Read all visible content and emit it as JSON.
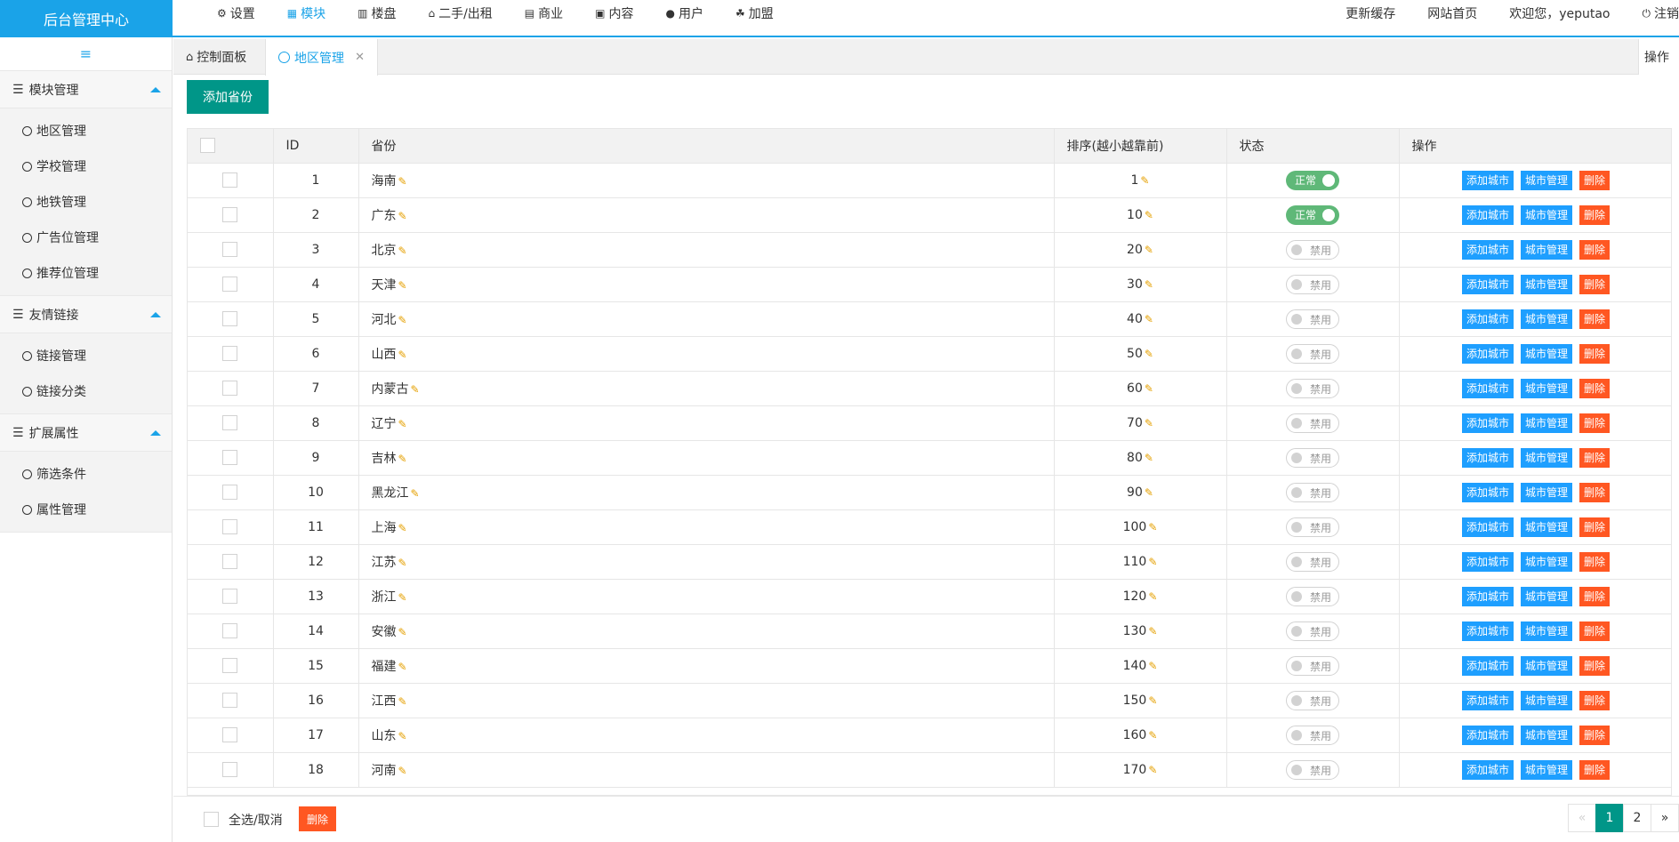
{
  "app": {
    "logo": "后台管理中心"
  },
  "topnav": [
    {
      "icon": "gear-icon",
      "glyph": "⚙",
      "label": "设置",
      "active": false
    },
    {
      "icon": "grid-icon",
      "glyph": "▦",
      "label": "模块",
      "active": true
    },
    {
      "icon": "building-icon",
      "glyph": "▥",
      "label": "楼盘",
      "active": false
    },
    {
      "icon": "home-icon",
      "glyph": "⌂",
      "label": "二手/出租",
      "active": false
    },
    {
      "icon": "bank-icon",
      "glyph": "▤",
      "label": "商业",
      "active": false
    },
    {
      "icon": "document-icon",
      "glyph": "▣",
      "label": "内容",
      "active": false
    },
    {
      "icon": "user-icon",
      "glyph": "●",
      "label": "用户",
      "active": false
    },
    {
      "icon": "users-icon",
      "glyph": "☘",
      "label": "加盟",
      "active": false
    }
  ],
  "topright": {
    "refresh_cache": "更新缓存",
    "site_home": "网站首页",
    "welcome": "欢迎您，yeputao",
    "logout_icon": "⏻",
    "logout": "注销"
  },
  "sidebar": {
    "toggle_icon": "≡",
    "groups": [
      {
        "title": "模块管理",
        "items": [
          "地区管理",
          "学校管理",
          "地铁管理",
          "广告位管理",
          "推荐位管理"
        ]
      },
      {
        "title": "友情链接",
        "items": [
          "链接管理",
          "链接分类"
        ]
      },
      {
        "title": "扩展属性",
        "items": [
          "筛选条件",
          "属性管理"
        ]
      }
    ]
  },
  "tabs": {
    "dashboard": "控制面板",
    "region": "地区管理",
    "close": "✕",
    "operations": "操作"
  },
  "toolbar": {
    "add_province": "添加省份"
  },
  "table": {
    "headers": {
      "id": "ID",
      "province": "省份",
      "sort": "排序(越小越靠前)",
      "status": "状态",
      "actions": "操作"
    },
    "status_on": "正常",
    "status_off": "禁用",
    "actions": {
      "add_city": "添加城市",
      "city_manage": "城市管理",
      "delete": "删除"
    },
    "rows": [
      {
        "id": "1",
        "name": "海南",
        "sort": "1",
        "on": true
      },
      {
        "id": "2",
        "name": "广东",
        "sort": "10",
        "on": true
      },
      {
        "id": "3",
        "name": "北京",
        "sort": "20",
        "on": false
      },
      {
        "id": "4",
        "name": "天津",
        "sort": "30",
        "on": false
      },
      {
        "id": "5",
        "name": "河北",
        "sort": "40",
        "on": false
      },
      {
        "id": "6",
        "name": "山西",
        "sort": "50",
        "on": false
      },
      {
        "id": "7",
        "name": "内蒙古",
        "sort": "60",
        "on": false
      },
      {
        "id": "8",
        "name": "辽宁",
        "sort": "70",
        "on": false
      },
      {
        "id": "9",
        "name": "吉林",
        "sort": "80",
        "on": false
      },
      {
        "id": "10",
        "name": "黑龙江",
        "sort": "90",
        "on": false
      },
      {
        "id": "11",
        "name": "上海",
        "sort": "100",
        "on": false
      },
      {
        "id": "12",
        "name": "江苏",
        "sort": "110",
        "on": false
      },
      {
        "id": "13",
        "name": "浙江",
        "sort": "120",
        "on": false
      },
      {
        "id": "14",
        "name": "安徽",
        "sort": "130",
        "on": false
      },
      {
        "id": "15",
        "name": "福建",
        "sort": "140",
        "on": false
      },
      {
        "id": "16",
        "name": "江西",
        "sort": "150",
        "on": false
      },
      {
        "id": "17",
        "name": "山东",
        "sort": "160",
        "on": false
      },
      {
        "id": "18",
        "name": "河南",
        "sort": "170",
        "on": false
      }
    ]
  },
  "footer": {
    "select_all": "全选/取消",
    "delete": "删除",
    "pager": {
      "prev": "«",
      "pages": [
        "1",
        "2"
      ],
      "current": "1",
      "next": "»"
    }
  }
}
